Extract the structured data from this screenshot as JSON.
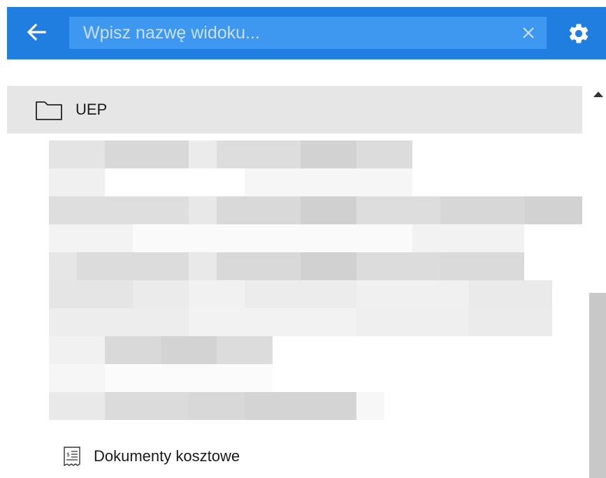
{
  "header": {
    "search_placeholder": "Wpisz nazwę widoku...",
    "search_value": ""
  },
  "tree": {
    "folder": {
      "label": "UEP"
    },
    "leaf": {
      "label": "Dokumenty kosztowe"
    }
  },
  "colors": {
    "header_bg": "#1f7ee0",
    "search_bg": "#3f98ef",
    "folder_row_bg": "#e6e6e6",
    "scroll_thumb": "#c8c8c8"
  },
  "icons": {
    "back": "arrow-left-icon",
    "clear": "close-icon",
    "settings": "gear-icon",
    "folder": "folder-icon",
    "document": "receipt-document-icon"
  }
}
